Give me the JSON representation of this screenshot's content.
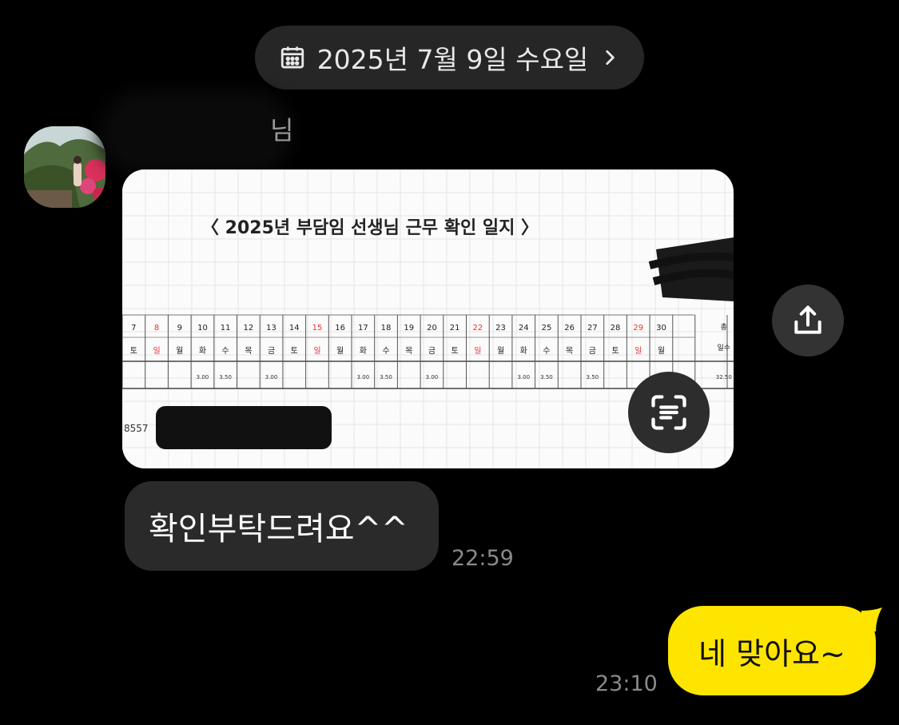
{
  "date_header": {
    "label": "2025년 7월 9일 수요일",
    "icon": "calendar-icon",
    "chevron": "chevron-right-icon"
  },
  "sender": {
    "name_suffix": "님"
  },
  "image_message": {
    "doc_title": "〈 2025년 부담임 선생님 근무 확인 일지 〉",
    "days": [
      "7",
      "8",
      "9",
      "10",
      "11",
      "12",
      "13",
      "14",
      "15",
      "16",
      "17",
      "18",
      "19",
      "20",
      "21",
      "22",
      "23",
      "24",
      "25",
      "26",
      "27",
      "28",
      "29",
      "30"
    ],
    "weekdays": [
      "토",
      "일",
      "월",
      "화",
      "수",
      "목",
      "금",
      "토",
      "일",
      "월",
      "화",
      "수",
      "목",
      "금",
      "토",
      "일",
      "월",
      "화",
      "수",
      "목",
      "금",
      "토",
      "일",
      "월"
    ],
    "red_days": [
      "8",
      "15",
      "22",
      "29"
    ],
    "hours": [
      "",
      "",
      "",
      "3.00",
      "3.50",
      "",
      "3.00",
      "",
      "",
      "",
      "3.00",
      "3.50",
      "",
      "3.00",
      "",
      "",
      "",
      "3.00",
      "3.50",
      "",
      "3.50",
      "",
      "",
      ""
    ],
    "total_header_top": "총",
    "total_header_bottom": "일수",
    "total_value": "32.50",
    "footer_number": "8557"
  },
  "received": {
    "text": "확인부탁드려요^^",
    "time": "22:59"
  },
  "sent": {
    "text": "네 맞아요~",
    "time": "23:10"
  },
  "colors": {
    "background": "#000000",
    "sent_bubble": "#fee500",
    "received_bubble": "#2a2a2a",
    "red_day": "#e8313b"
  },
  "buttons": {
    "share": "share-icon",
    "scan_text": "text-scan-icon"
  }
}
